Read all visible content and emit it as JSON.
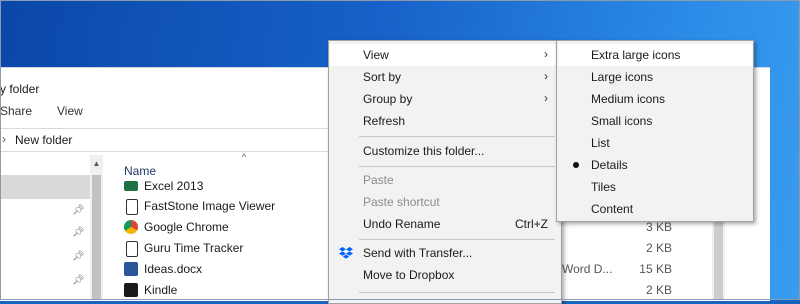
{
  "explorer": {
    "title": "y folder",
    "ribbon_tabs": [
      "Share",
      "View"
    ],
    "breadcrumb": "New folder",
    "column_header": "Name",
    "files": [
      {
        "name": "Excel 2013",
        "icon": "excel-icon",
        "type": "",
        "size": ""
      },
      {
        "name": "FastStone Image Viewer",
        "icon": "image-viewer-icon",
        "type": "",
        "size": ""
      },
      {
        "name": "Google Chrome",
        "icon": "chrome-icon",
        "type": "",
        "size": ""
      },
      {
        "name": "Guru Time Tracker",
        "icon": "app-icon",
        "type": "",
        "size": "2 KB"
      },
      {
        "name": "Ideas.docx",
        "icon": "word-icon",
        "type": "Word D...",
        "size": "15 KB"
      },
      {
        "name": "Kindle",
        "icon": "kindle-icon",
        "type": "",
        "size": "2 KB"
      }
    ],
    "extra_size_first": "3 KB"
  },
  "context_menu": {
    "items": [
      {
        "label": "View",
        "submenu": true
      },
      {
        "label": "Sort by",
        "submenu": true
      },
      {
        "label": "Group by",
        "submenu": true
      },
      {
        "label": "Refresh"
      },
      {
        "label": "Customize this folder..."
      },
      {
        "label": "Paste",
        "disabled": true
      },
      {
        "label": "Paste shortcut",
        "disabled": true
      },
      {
        "label": "Undo Rename",
        "shortcut": "Ctrl+Z"
      },
      {
        "label": "Send with Transfer...",
        "icon": "dropbox-icon"
      },
      {
        "label": "Move to Dropbox"
      }
    ]
  },
  "view_submenu": {
    "items": [
      {
        "label": "Extra large icons"
      },
      {
        "label": "Large icons"
      },
      {
        "label": "Medium icons"
      },
      {
        "label": "Small icons"
      },
      {
        "label": "List"
      },
      {
        "label": "Details",
        "selected": true
      },
      {
        "label": "Tiles"
      },
      {
        "label": "Content"
      }
    ]
  },
  "colors": {
    "menu_bg": "#f2f2f2",
    "hover_bg": "#ffffff",
    "desktop": "#1761c8",
    "dropbox": "#0061fe"
  }
}
